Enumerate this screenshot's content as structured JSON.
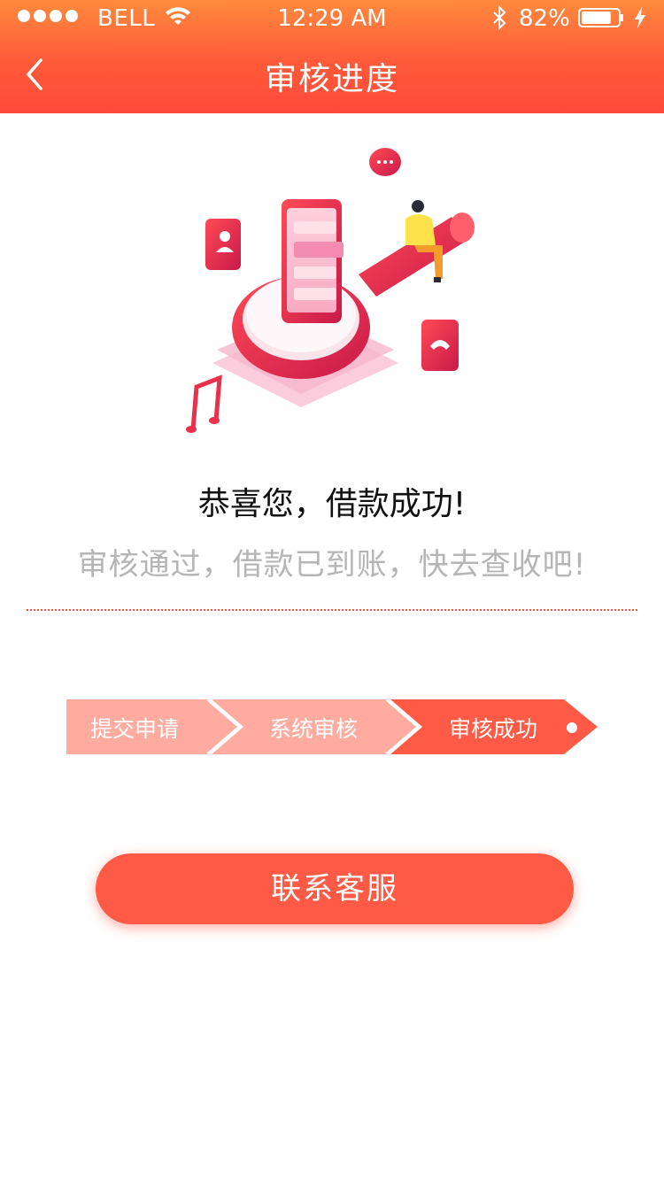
{
  "status_bar": {
    "carrier": "BELL",
    "time": "12:29 AM",
    "battery_percent": "82%",
    "battery_level": 0.82
  },
  "nav": {
    "title": "审核进度",
    "back_icon": "chevron-left-icon"
  },
  "result": {
    "headline": "恭喜您，借款成功!",
    "subtitle": "审核通过，借款已到账，快去查收吧!"
  },
  "steps": [
    {
      "label": "提交申请",
      "state": "done"
    },
    {
      "label": "系统审核",
      "state": "done"
    },
    {
      "label": "审核成功",
      "state": "current"
    }
  ],
  "actions": {
    "contact_label": "联系客服"
  },
  "colors": {
    "header_top": "#ff8a3d",
    "header_bottom": "#ff4a3a",
    "accent": "#ff5a45",
    "step_done": "#ffaba0",
    "step_current": "#ff5a45",
    "subtitle_text": "#b5b5b5"
  }
}
